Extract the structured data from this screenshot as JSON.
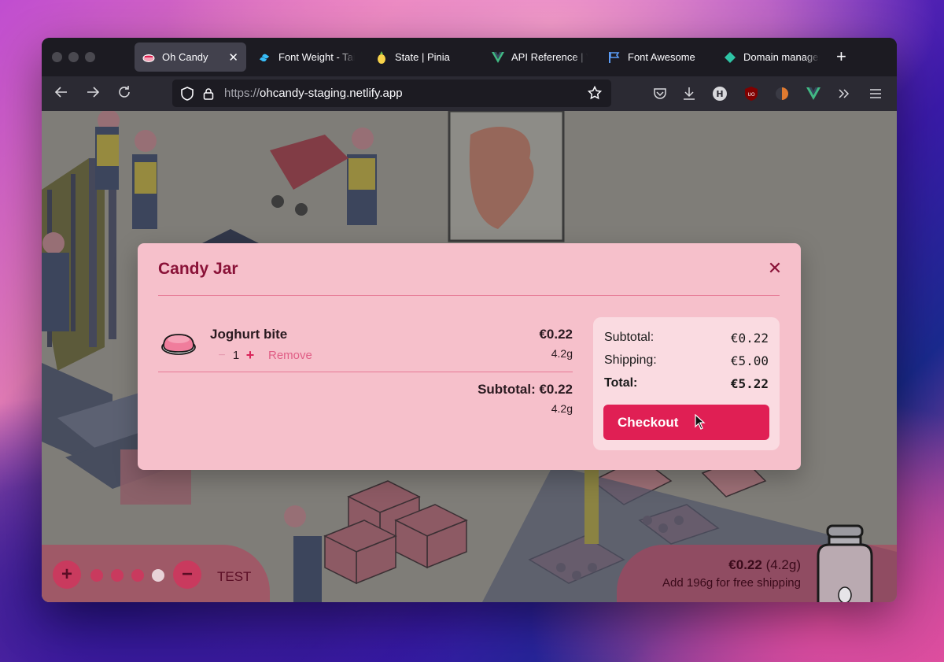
{
  "browser": {
    "tabs": [
      {
        "label": "Oh Candy",
        "icon": "candy-icon",
        "active": true
      },
      {
        "label": "Font Weight - Tail",
        "icon": "tailwind-icon"
      },
      {
        "label": "State | Pinia",
        "icon": "pineapple-icon"
      },
      {
        "label": "API Reference | V",
        "icon": "vue-icon"
      },
      {
        "label": "Font Awesome",
        "icon": "flag-icon"
      },
      {
        "label": "Domain managem",
        "icon": "netlify-icon"
      }
    ],
    "url_scheme": "https://",
    "url_host": "ohcandy-staging.netlify.app"
  },
  "modal": {
    "title": "Candy Jar",
    "item": {
      "name": "Joghurt bite",
      "quantity": "1",
      "remove_label": "Remove",
      "price": "€0.22",
      "weight": "4.2g"
    },
    "subtotal_line": "Subtotal: €0.22",
    "subtotal_weight": "4.2g",
    "summary": {
      "subtotal_label": "Subtotal:",
      "subtotal_value": "€0.22",
      "shipping_label": "Shipping:",
      "shipping_value": "€5.00",
      "total_label": "Total:",
      "total_value": "€5.22",
      "checkout_label": "Checkout"
    }
  },
  "footer": {
    "test_label": "TEST",
    "jar_price": "€0.22",
    "jar_weight": "(4.2g)",
    "free_shipping": "Add 196g for free shipping"
  },
  "colors": {
    "accent": "#e01f54",
    "modal_bg": "#f6c0cb",
    "title": "#8a1238"
  }
}
